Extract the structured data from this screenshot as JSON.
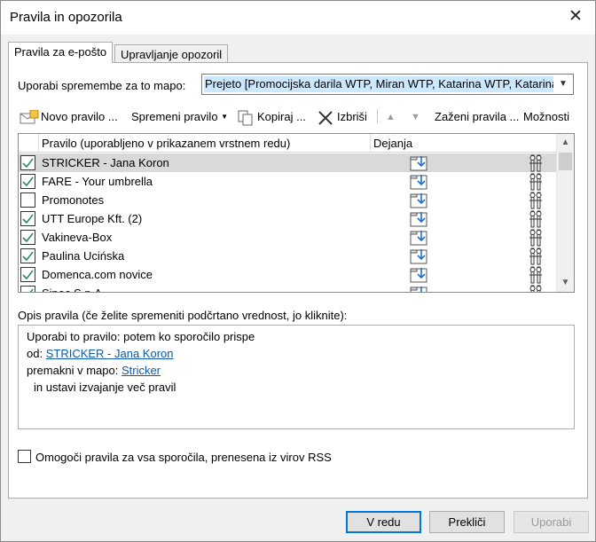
{
  "window": {
    "title": "Pravila in opozorila"
  },
  "tabs": [
    {
      "label": "Pravila za e-pošto",
      "active": true
    },
    {
      "label": "Upravljanje opozoril",
      "active": false
    }
  ],
  "folder": {
    "label": "Uporabi spremembe za to mapo:",
    "value": "Prejeto [Promocijska darila WTP, Miran WTP, Katarina WTP, Katarina"
  },
  "toolbar": {
    "new_rule": "Novo pravilo ...",
    "change_rule": "Spremeni pravilo",
    "copy": "Kopiraj ...",
    "delete": "Izbriši",
    "run_rules": "Zaženi pravila ...",
    "options": "Možnosti"
  },
  "rules_table": {
    "columns": [
      "Pravilo (uporabljeno v prikazanem vrstnem redu)",
      "Dejanja"
    ],
    "rows": [
      {
        "name": "STRICKER - Jana Koron",
        "checked": true,
        "selected": true
      },
      {
        "name": "FARE - Your umbrella",
        "checked": true,
        "selected": false
      },
      {
        "name": "Promonotes",
        "checked": false,
        "selected": false
      },
      {
        "name": "UTT Europe Kft. (2)",
        "checked": true,
        "selected": false
      },
      {
        "name": "Vakineva-Box",
        "checked": true,
        "selected": false
      },
      {
        "name": "Paulina Ucińska",
        "checked": true,
        "selected": false
      },
      {
        "name": "Domenca.com novice",
        "checked": true,
        "selected": false
      },
      {
        "name": "Sipec S.p.A.",
        "checked": true,
        "selected": false
      }
    ]
  },
  "description": {
    "label": "Opis pravila (če želite spremeniti podčrtano vrednost, jo kliknite):",
    "line1": "Uporabi to pravilo: potem ko sporočilo prispe",
    "from_prefix": "od:",
    "from_link": "STRICKER - Jana Koron",
    "move_prefix": "premakni v mapo:",
    "move_link": "Stricker",
    "line4": "in ustavi izvajanje več pravil"
  },
  "rss": {
    "label": "Omogoči pravila za vsa sporočila, prenesena iz virov RSS",
    "checked": false
  },
  "buttons": {
    "ok": "V redu",
    "cancel": "Prekliči",
    "apply": "Uporabi"
  },
  "colors": {
    "accent": "#0078d7",
    "selection": "#cce8ff",
    "link": "#0b59a8",
    "check": "#2e8b57"
  }
}
